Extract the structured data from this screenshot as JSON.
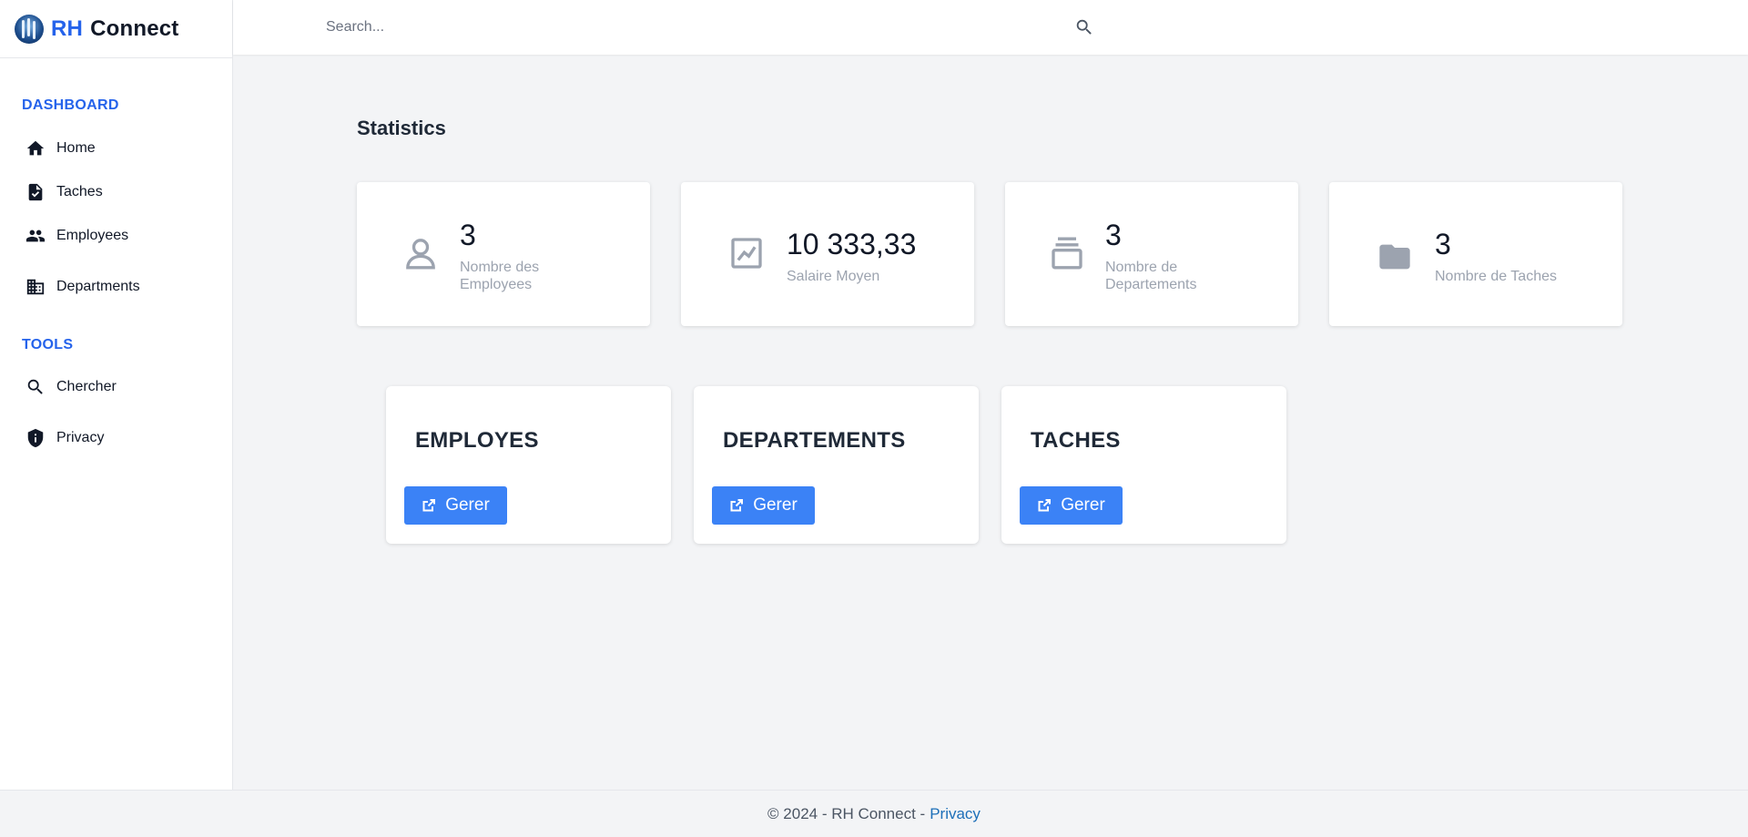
{
  "brand": {
    "rh": "RH",
    "connect": "Connect"
  },
  "search": {
    "placeholder": "Search..."
  },
  "sidebar": {
    "sections": [
      {
        "title": "DASHBOARD",
        "items": [
          {
            "label": "Home",
            "icon": "home-icon"
          },
          {
            "label": "Taches",
            "icon": "task-file-icon"
          },
          {
            "label": "Employees",
            "icon": "people-icon"
          },
          {
            "label": "Departments",
            "icon": "building-icon"
          }
        ]
      },
      {
        "title": "TOOLS",
        "items": [
          {
            "label": "Chercher",
            "icon": "search-icon"
          },
          {
            "label": "Privacy",
            "icon": "shield-icon"
          }
        ]
      }
    ]
  },
  "main": {
    "title": "Statistics",
    "stats": [
      {
        "value": "3",
        "label": "Nombre des Employees",
        "icon": "user-icon"
      },
      {
        "value": "10 333,33",
        "label": "Salaire Moyen",
        "icon": "chart-icon"
      },
      {
        "value": "3",
        "label": "Nombre de Departements",
        "icon": "stack-icon"
      },
      {
        "value": "3",
        "label": "Nombre de Taches",
        "icon": "folder-icon"
      }
    ],
    "management": [
      {
        "title": "EMPLOYES",
        "button": "Gerer"
      },
      {
        "title": "DEPARTEMENTS",
        "button": "Gerer"
      },
      {
        "title": "TACHES",
        "button": "Gerer"
      }
    ]
  },
  "footer": {
    "text": "© 2024 - RH Connect -",
    "link": "Privacy"
  },
  "colors": {
    "accent": "#2563eb",
    "button": "#3b82f6",
    "background": "#f3f4f6"
  }
}
